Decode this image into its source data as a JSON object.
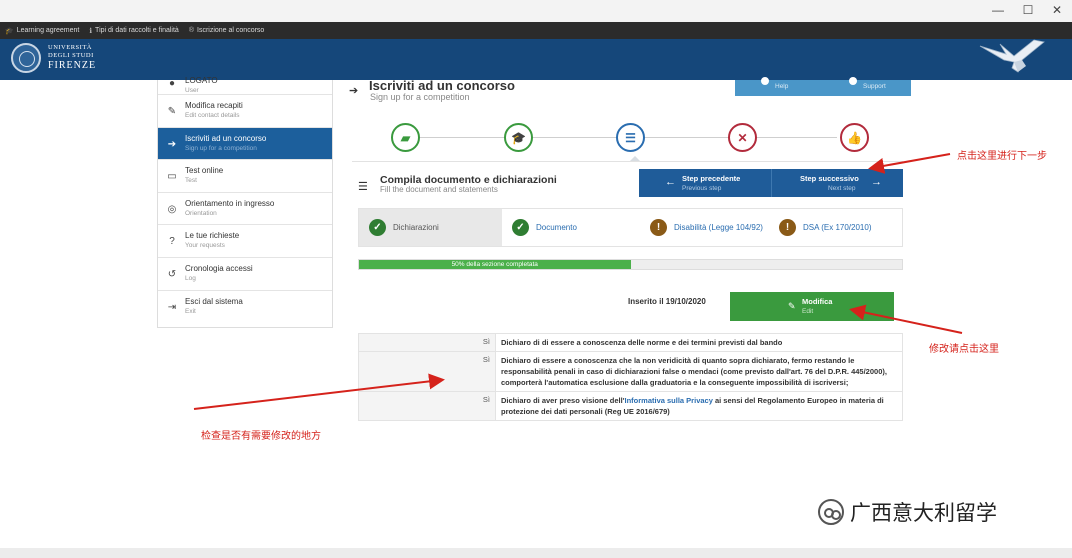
{
  "window": {
    "minimize": "—",
    "maximize": "☐",
    "close": "✕"
  },
  "bookmarks": [
    {
      "icon": "graduation-cap-icon",
      "label": "Learning agreement"
    },
    {
      "icon": "info-icon",
      "label": "Tipi di dati raccolti e finalità"
    },
    {
      "icon": "registered-icon",
      "label": "Iscrizione al concorso"
    }
  ],
  "header": {
    "university_line1": "UNIVERSITÀ",
    "university_line2": "DEGLI STUDI",
    "university_line3": "FIRENZE",
    "colors": {
      "bar": "#15477a"
    }
  },
  "sidebar": {
    "items": [
      {
        "title": "LOGATO",
        "subtitle": "User",
        "active": false
      },
      {
        "title": "Modifica recapiti",
        "subtitle": "Edit contact details",
        "active": false
      },
      {
        "title": "Iscriviti ad un concorso",
        "subtitle": "Sign up for a competition",
        "active": true
      },
      {
        "title": "Test online",
        "subtitle": "Test",
        "active": false
      },
      {
        "title": "Orientamento in ingresso",
        "subtitle": "Orientation",
        "active": false
      },
      {
        "title": "Le tue richieste",
        "subtitle": "Your requests",
        "active": false
      },
      {
        "title": "Cronologia accessi",
        "subtitle": "Log",
        "active": false
      },
      {
        "title": "Esci dal sistema",
        "subtitle": "Exit",
        "active": false
      }
    ]
  },
  "page": {
    "title": "Iscriviti ad un concorso",
    "subtitle": "Sign up for a competition",
    "help_label": "Help",
    "support_label": "Support"
  },
  "stepper": {
    "current_index": 2,
    "steps": [
      {
        "icon": "folder-open-icon",
        "glyph": "▰",
        "color": "#3a9a3e"
      },
      {
        "icon": "graduation-cap-icon",
        "glyph": "🎓",
        "color": "#3a9a3e"
      },
      {
        "icon": "list-icon",
        "glyph": "☰",
        "color": "#2a6db0"
      },
      {
        "icon": "shuffle-icon",
        "glyph": "✕",
        "color": "#b22b3c"
      },
      {
        "icon": "thumbs-up-icon",
        "glyph": "👍",
        "color": "#b22b3c"
      }
    ]
  },
  "section": {
    "title": "Compila documento e dichiarazioni",
    "subtitle": "Fill the document and statements",
    "prev_label": "Step precedente",
    "prev_sub": "Previous step",
    "next_label": "Step successivo",
    "next_sub": "Next step"
  },
  "decl_tabs": [
    {
      "label": "Dichiarazioni",
      "status": "ok",
      "icon": "check-circle-icon",
      "mark": "✓",
      "active": true
    },
    {
      "label": "Documento",
      "status": "ok",
      "icon": "check-circle-icon",
      "mark": "✓",
      "active": false
    },
    {
      "label": "Disabilità (Legge 104/92)",
      "status": "warn",
      "icon": "exclamation-circle-icon",
      "mark": "!",
      "active": false
    },
    {
      "label": "DSA (Ex 170/2010)",
      "status": "warn",
      "icon": "exclamation-circle-icon",
      "mark": "!",
      "active": false
    }
  ],
  "progress": {
    "value": 0.5,
    "label": "50% della sezione completata",
    "color": "#4bb04a"
  },
  "inserted": "Inserito il 19/10/2020",
  "edit_button": {
    "label": "Modifica",
    "sub": "Edit"
  },
  "declarations": [
    {
      "answer": "Sì",
      "text": "Dichiaro di di essere a conoscenza delle norme e dei termini previsti dal bando"
    },
    {
      "answer": "Sì",
      "text": "Dichiaro di essere a conoscenza che la non veridicità di quanto sopra dichiarato, fermo restando le responsabilità penali in caso di dichiarazioni false o mendaci (come previsto dall'art. 76 del D.P.R. 445/2000), comporterà l'automatica esclusione dalla graduatoria e la conseguente impossibilità di iscriversi;"
    },
    {
      "answer": "Sì",
      "text_before": "Dichiaro di aver preso visione dell'",
      "link": "Informativa sulla Privacy",
      "text_after": " ai sensi del Regolamento Europeo in materia di protezione dei dati personali (Reg UE 2016/679)"
    }
  ],
  "annotations": {
    "next_step": "点击这里进行下一步",
    "edit_here": "修改请点击这里",
    "check_changes": "检查是否有需要修改的地方",
    "color": "#d5221b"
  },
  "watermark": "广西意大利留学"
}
